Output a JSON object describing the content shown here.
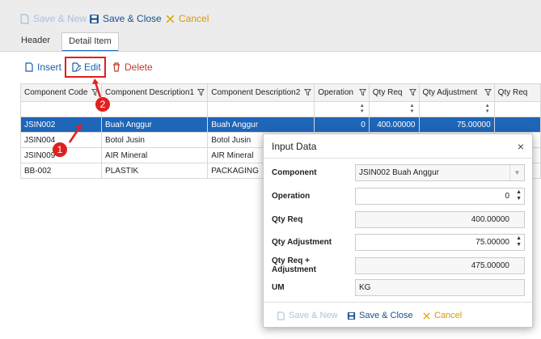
{
  "toolbar": {
    "save_new": "Save & New",
    "save_close": "Save & Close",
    "cancel": "Cancel"
  },
  "tabs": [
    {
      "label": "Header"
    },
    {
      "label": "Detail Item"
    }
  ],
  "detail_toolbar": {
    "insert": "Insert",
    "edit": "Edit",
    "delete": "Delete"
  },
  "grid": {
    "columns": [
      "Component Code",
      "Component Description1",
      "Component Description2",
      "Operation",
      "Qty Req",
      "Qty Adjustment",
      "Qty Req"
    ],
    "rows": [
      {
        "code": "JSIN002",
        "desc1": "Buah Anggur",
        "desc2": "Buah Anggur",
        "operation": "0",
        "qty_req": "400.00000",
        "qty_adj": "75.00000",
        "selected": true
      },
      {
        "code": "JSIN004",
        "desc1": "Botol Jusin",
        "desc2": "Botol Jusin",
        "operation": "",
        "qty_req": "",
        "qty_adj": "",
        "selected": false
      },
      {
        "code": "JSIN009",
        "desc1": "AIR Mineral",
        "desc2": "AIR Mineral",
        "operation": "",
        "qty_req": "",
        "qty_adj": "",
        "selected": false
      },
      {
        "code": "BB-002",
        "desc1": "PLASTIK",
        "desc2": "PACKAGING",
        "operation": "",
        "qty_req": "",
        "qty_adj": "",
        "selected": false
      }
    ]
  },
  "markers": {
    "one": "1",
    "two": "2"
  },
  "dialog": {
    "title": "Input Data",
    "close": "×",
    "fields": {
      "component": {
        "label": "Component",
        "value": "JSIN002 Buah Anggur"
      },
      "operation": {
        "label": "Operation",
        "value": "0"
      },
      "qty_req": {
        "label": "Qty Req",
        "value": "400.00000"
      },
      "qty_adjustment": {
        "label": "Qty Adjustment",
        "value": "75.00000"
      },
      "qty_total": {
        "label": "Qty Req + Adjustment",
        "value": "475.00000"
      },
      "um": {
        "label": "UM",
        "value": "KG"
      }
    },
    "footer": {
      "save_new": "Save & New",
      "save_close": "Save & Close",
      "cancel": "Cancel"
    }
  },
  "colors": {
    "accent": "#1565c0",
    "selected_row": "#1f65b8",
    "cancel": "#e0a400",
    "delete": "#c0392b",
    "marker": "#e41e1e"
  },
  "icons": [
    "save-new-icon",
    "save-icon",
    "cancel-icon",
    "insert-icon",
    "edit-icon",
    "delete-icon",
    "filter-icon",
    "close-icon"
  ]
}
